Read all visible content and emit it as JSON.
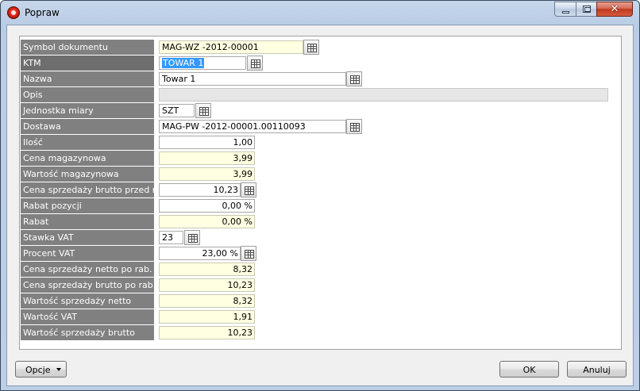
{
  "window": {
    "title": "Popraw",
    "close_glyph": "✕"
  },
  "form": {
    "rows": [
      {
        "label": "Symbol dokumentu",
        "value": "MAG-WZ -2012-00001",
        "picker": true
      },
      {
        "label": "KTM",
        "value": "TOWAR 1",
        "picker": true,
        "selected": true
      },
      {
        "label": "Nazwa",
        "value": "Towar 1",
        "picker": true
      },
      {
        "label": "Opis",
        "value": ""
      },
      {
        "label": "Jednostka miary",
        "value": "SZT",
        "picker": true
      },
      {
        "label": "Dostawa",
        "value": "MAG-PW -2012-00001.00110093",
        "picker": true
      },
      {
        "label": "Ilość",
        "value": "1,00"
      },
      {
        "label": "Cena magazynowa",
        "value": "3,99"
      },
      {
        "label": "Wartość magazynowa",
        "value": "3,99"
      },
      {
        "label": "Cena sprzedaży brutto przed rab.",
        "value": "10,23",
        "picker": true
      },
      {
        "label": "Rabat pozycji",
        "value": "0,00 %"
      },
      {
        "label": "Rabat",
        "value": "0,00 %"
      },
      {
        "label": "Stawka VAT",
        "value": "23",
        "picker": true
      },
      {
        "label": "Procent VAT",
        "value": "23,00 %",
        "picker": true
      },
      {
        "label": "Cena sprzedaży netto po rab.",
        "value": "8,32"
      },
      {
        "label": "Cena sprzedaży brutto po rab.",
        "value": "10,23"
      },
      {
        "label": "Wartość sprzedaży netto",
        "value": "8,32"
      },
      {
        "label": "Wartość VAT",
        "value": "1,91"
      },
      {
        "label": "Wartość sprzedaży brutto",
        "value": "10,23"
      }
    ]
  },
  "footer": {
    "options_label": "Opcje",
    "ok_label": "OK",
    "cancel_label": "Anuluj"
  },
  "icons": {
    "app": "app-logo-icon",
    "picker": "lookup-table-icon"
  },
  "colors": {
    "label_bg": "#808080",
    "readonly_bg": "#ffffe1",
    "selection": "#3399ff",
    "close_button": "#c0391f"
  }
}
